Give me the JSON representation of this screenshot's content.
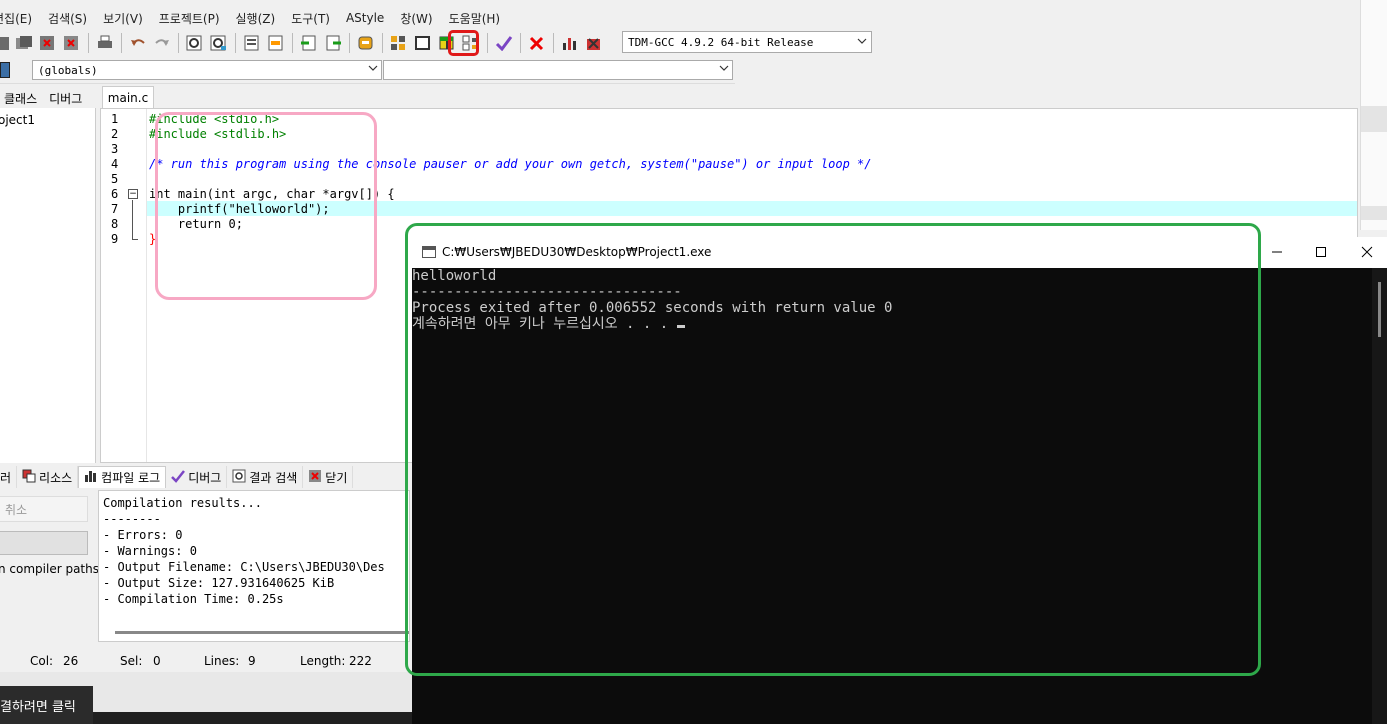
{
  "menu": [
    "편집(E)",
    "검색(S)",
    "보기(V)",
    "프로젝트(P)",
    "실행(Z)",
    "도구(T)",
    "AStyle",
    "창(W)",
    "도움말(H)"
  ],
  "toolbar": {
    "compiler": "TDM-GCC 4.9.2 64-bit Release",
    "icons": [
      "new-icon",
      "open-icon",
      "close-icon",
      "close-all-icon",
      "print-icon",
      "undo-icon",
      "redo-icon",
      "find-icon",
      "replace-icon",
      "indent-icon",
      "unindent-icon",
      "goto-icon",
      "back-icon",
      "bookmark-icon",
      "compile-icon",
      "run-icon",
      "compile-run-icon",
      "rebuild-icon",
      "check-icon",
      "stop-icon",
      "chart-icon",
      "debug-icon"
    ]
  },
  "scope": {
    "globals": "(globals)",
    "second": ""
  },
  "left_tabs": [
    "클래스",
    "디버그"
  ],
  "project_item": "oject1",
  "editor": {
    "tab": "main.c",
    "line_numbers": [
      "1",
      "2",
      "3",
      "4",
      "5",
      "6",
      "7",
      "8",
      "9"
    ],
    "lines": [
      "#include <stdio.h>",
      "#include <stdlib.h>",
      "",
      "/* run this program using the console pauser or add your own getch, system(\"pause\") or input loop */",
      "",
      "int main(int argc, char *argv[]) {",
      "    printf(\"helloworld\");",
      "    return 0;",
      "}"
    ]
  },
  "bottom_tabs": [
    "러",
    "리소스",
    "컴파일 로그",
    "디버그",
    "결과 검색",
    "닫기"
  ],
  "bottom_left": {
    "cancel": "취소",
    "compiler_paths": "n compiler paths"
  },
  "compile_log": [
    "Compilation results...",
    "--------",
    "- Errors: 0",
    "- Warnings: 0",
    "- Output Filename: C:\\Users\\JBEDU30\\Des",
    "- Output Size: 127.931640625 KiB",
    "- Compilation Time: 0.25s"
  ],
  "status": {
    "col_label": "Col:",
    "col": "26",
    "sel_label": "Sel:",
    "sel": "0",
    "lines_label": "Lines:",
    "lines": "9",
    "length_label": "Length:",
    "length": "222"
  },
  "tooltip": "결하려면 클릭",
  "console": {
    "title": "C:₩Users₩JBEDU30₩Desktop₩Project1.exe",
    "output": [
      "helloworld",
      "--------------------------------",
      "Process exited after 0.006552 seconds with return value 0",
      "계속하려면 아무 키나 누르십시오 . . . "
    ]
  },
  "colors": {
    "annotation_pink": "#f7a8c4",
    "annotation_green": "#2ea84a",
    "annotation_red": "#e01919",
    "line_highlight": "#ccffff",
    "console_bg": "#0c0c0c"
  }
}
